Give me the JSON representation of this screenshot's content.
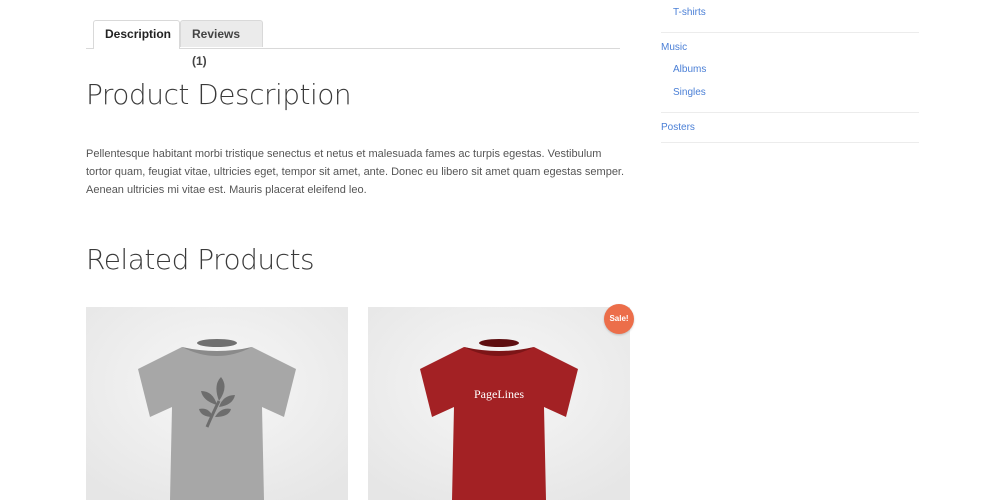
{
  "tabs": {
    "description": "Description",
    "reviews": "Reviews (1)"
  },
  "product_description": {
    "title": "Product Description",
    "text": "Pellentesque habitant morbi tristique senectus et netus et malesuada fames ac turpis egestas. Vestibulum tortor quam, feugiat vitae, ultricies eget, tempor sit amet, ante. Donec eu libero sit amet quam egestas semper. Aenean ultricies mi vitae est. Mauris placerat eleifend leo."
  },
  "related": {
    "title": "Related Products",
    "products": [
      {
        "shirt_color": "#9a9a9a",
        "icon": "leaf-icon"
      },
      {
        "shirt_color": "#a01f22",
        "shirt_text": "PageLines",
        "badge": "Sale!"
      }
    ]
  },
  "sidebar": {
    "tshirts": "T-shirts",
    "music": "Music",
    "albums": "Albums",
    "singles": "Singles",
    "posters": "Posters"
  },
  "colors": {
    "link": "#4a7fd6",
    "sale_badge": "#ec6e4a"
  }
}
